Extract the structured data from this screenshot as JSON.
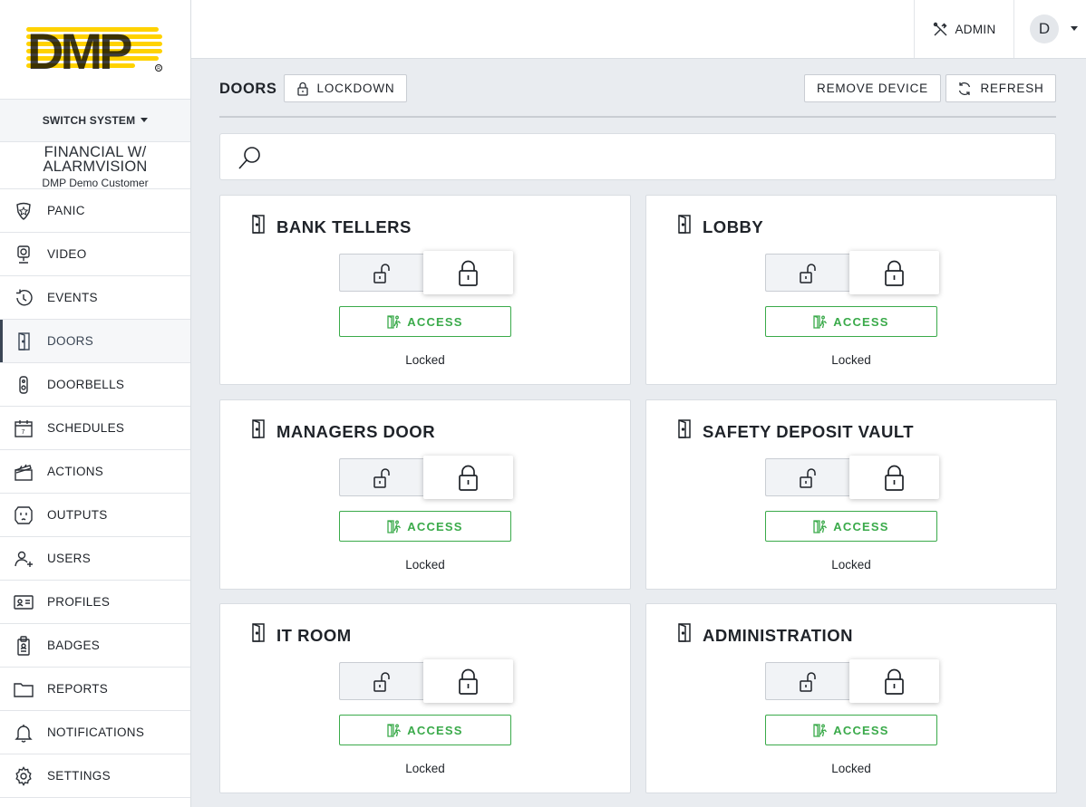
{
  "brand": {
    "logo_text": "DMP",
    "logo_color": "#ffd200",
    "logo_dark": "#1a1a1a"
  },
  "sidebar": {
    "switch_label": "SWITCH SYSTEM",
    "customer_name": "FINANCIAL W/ ALARMVISION",
    "customer_sub": "DMP Demo Customer",
    "items": [
      {
        "label": "PANIC",
        "icon": "police-badge-icon"
      },
      {
        "label": "VIDEO",
        "icon": "camera-icon"
      },
      {
        "label": "EVENTS",
        "icon": "history-icon"
      },
      {
        "label": "DOORS",
        "icon": "door-icon",
        "active": true
      },
      {
        "label": "DOORBELLS",
        "icon": "doorbell-icon"
      },
      {
        "label": "SCHEDULES",
        "icon": "calendar-icon"
      },
      {
        "label": "ACTIONS",
        "icon": "clapperboard-icon"
      },
      {
        "label": "OUTPUTS",
        "icon": "outlet-icon"
      },
      {
        "label": "USERS",
        "icon": "users-icon"
      },
      {
        "label": "PROFILES",
        "icon": "id-card-icon"
      },
      {
        "label": "BADGES",
        "icon": "badge-clip-icon"
      },
      {
        "label": "REPORTS",
        "icon": "folder-icon"
      },
      {
        "label": "NOTIFICATIONS",
        "icon": "bell-icon"
      },
      {
        "label": "SETTINGS",
        "icon": "gear-icon"
      }
    ]
  },
  "topbar": {
    "admin_label": "ADMIN",
    "avatar_initial": "D"
  },
  "header": {
    "title": "DOORS",
    "lockdown_label": "LOCKDOWN",
    "remove_label": "REMOVE DEVICE",
    "refresh_label": "REFRESH"
  },
  "search": {
    "placeholder": "",
    "value": ""
  },
  "doors": [
    {
      "name": "BANK TELLERS",
      "access_label": "ACCESS",
      "status": "Locked"
    },
    {
      "name": "LOBBY",
      "access_label": "ACCESS",
      "status": "Locked"
    },
    {
      "name": "MANAGERS DOOR",
      "access_label": "ACCESS",
      "status": "Locked"
    },
    {
      "name": "SAFETY DEPOSIT VAULT",
      "access_label": "ACCESS",
      "status": "Locked"
    },
    {
      "name": "IT ROOM",
      "access_label": "ACCESS",
      "status": "Locked"
    },
    {
      "name": "ADMINISTRATION",
      "access_label": "ACCESS",
      "status": "Locked"
    }
  ],
  "colors": {
    "access_green": "#3aaa4a",
    "active_bar": "#3a4554",
    "page_bg": "#e9ecf0"
  }
}
